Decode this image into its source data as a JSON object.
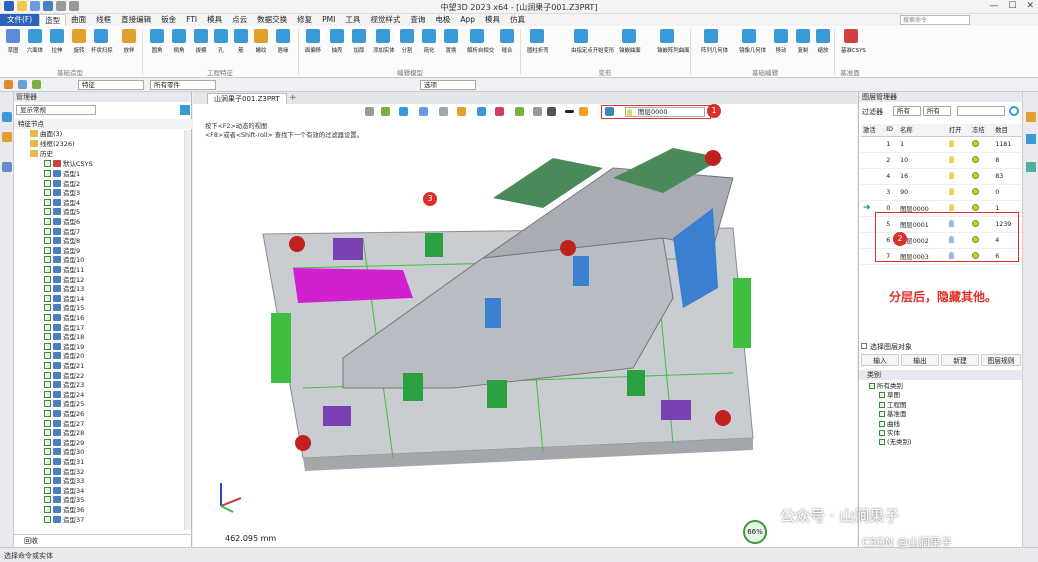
{
  "window": {
    "title": "中望3D 2023 x64 - [山涧果子001.Z3PRT]"
  },
  "menu": {
    "items": [
      "文件(F)",
      "造型",
      "曲面",
      "线框",
      "直接编辑",
      "钣金",
      "FTI",
      "模具",
      "点云",
      "数据交换",
      "修复",
      "PMI",
      "工具",
      "视觉样式",
      "查询",
      "电极",
      "App",
      "模具",
      "仿真"
    ],
    "search_placeholder": "搜索命令"
  },
  "ribbon": {
    "buttons": [
      "草图",
      "六面体",
      "拉伸",
      "旋转",
      "扫掠",
      "杆状扫掠",
      "放样",
      "圆角",
      "倒角",
      "拔模",
      "孔",
      "筋",
      "螺纹",
      "唇缘",
      "坯料",
      "面偏移",
      "抽壳",
      "加厚",
      "添加实体",
      "分割",
      "简化",
      "置换",
      "解析自相交",
      "缝合",
      "圆柱折弯",
      "由指定点开始变形",
      "镶嵌曲面",
      "镶嵌阵列曲面",
      "阵列几何体",
      "镜像几何体",
      "移动",
      "复制",
      "缩放",
      "基准CSYS"
    ],
    "groups": [
      "基础造型",
      "工程特征",
      "编辑模型",
      "变形",
      "基础编辑",
      "基准面"
    ]
  },
  "toolbar2": {
    "filter": "特征",
    "filter2": "所有零件",
    "filter3": "选项"
  },
  "manager": {
    "title": "管理器",
    "display": "显示常规",
    "root": "特征节点",
    "surfaces": "曲面(3)",
    "wireframe": "线框(2326)",
    "history": "历史",
    "csys": "默认CSYS",
    "features": [
      "造型1",
      "造型2",
      "造型3",
      "造型4",
      "造型5",
      "造型6",
      "造型7",
      "造型8",
      "造型9",
      "造型10",
      "造型11",
      "造型12",
      "造型13",
      "造型14",
      "造型15",
      "造型16",
      "造型17",
      "造型18",
      "造型19",
      "造型20",
      "造型21",
      "造型22",
      "造型23",
      "造型24",
      "造型25",
      "造型26",
      "造型27",
      "造型28",
      "造型29",
      "造型30",
      "造型31",
      "造型32",
      "造型33",
      "造型34",
      "造型35",
      "造型36",
      "造型37"
    ],
    "footer": "回收"
  },
  "viewport": {
    "tab": "山涧果子001.Z3PRT",
    "layer_combo": "图层0000",
    "hint1": "按下<F2>动态的视图",
    "hint2": "<F8>或者<Shift-roll> 查找下一个有效的过滤器设置。",
    "scale": "462.095 mm",
    "markers": [
      "1",
      "2",
      "3"
    ]
  },
  "layer_manager": {
    "title": "图层管理器",
    "filter_label": "过滤器",
    "filter_a": "所有",
    "filter_b": "所有",
    "columns": [
      "激活",
      "ID",
      "名称",
      "打开",
      "冻结",
      "数目"
    ],
    "rows": [
      {
        "id": "1",
        "name": "1",
        "count": "1181"
      },
      {
        "id": "2",
        "name": "10",
        "count": "8"
      },
      {
        "id": "4",
        "name": "16",
        "count": "83"
      },
      {
        "id": "3",
        "name": "90",
        "count": "0"
      },
      {
        "id": "0",
        "name": "图层0000",
        "count": "1"
      },
      {
        "id": "5",
        "name": "图层0001",
        "count": "1239"
      },
      {
        "id": "6",
        "name": "图层0002",
        "count": "4"
      },
      {
        "id": "7",
        "name": "图层0003",
        "count": "6"
      }
    ],
    "annotation": "分层后，隐藏其他。",
    "select_objects": "选择图层对象",
    "buttons": [
      "输入",
      "输出",
      "新建",
      "图层规则"
    ],
    "category_title": "类别",
    "categories": [
      "所有类别",
      "草图",
      "工程图",
      "基准面",
      "曲线",
      "实体",
      "(无类别)"
    ]
  },
  "status": {
    "text": "选择命令或实体",
    "cpu": "66%"
  },
  "watermark": {
    "wechat": "公众号 · 山涧果子",
    "csdn": "CSDN @山涧果子"
  },
  "colors": {
    "accent": "#2b63b8",
    "annotation": "#e0302a",
    "part_gray": "#b9bcc2",
    "green": "#3fbf3f",
    "magenta": "#d020d0",
    "blue": "#3a7fd0"
  }
}
